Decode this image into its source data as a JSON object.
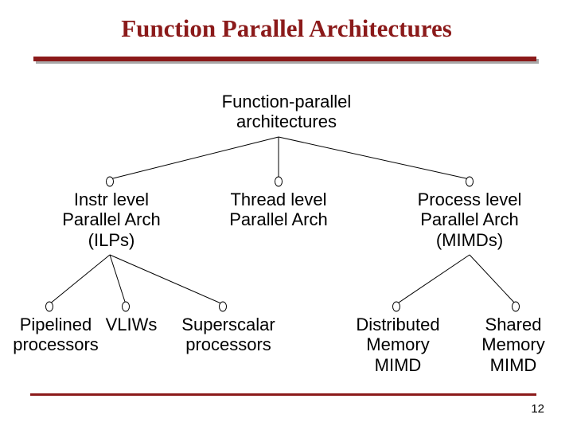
{
  "title": "Function Parallel Architectures",
  "root": {
    "line1": "Function-parallel",
    "line2": "architectures"
  },
  "level2": {
    "instr": {
      "line1": "Instr level",
      "line2": "Parallel Arch",
      "line3": "(ILPs)"
    },
    "thread": {
      "line1": "Thread level",
      "line2": "Parallel Arch"
    },
    "process": {
      "line1": "Process level",
      "line2": "Parallel Arch",
      "line3": "(MIMDs)"
    }
  },
  "leaves": {
    "pipelined": {
      "line1": "Pipelined",
      "line2": "processors"
    },
    "vliws": {
      "line1": "VLIWs"
    },
    "superscalar": {
      "line1": "Superscalar",
      "line2": "processors"
    },
    "distributed": {
      "line1": "Distributed",
      "line2": "Memory",
      "line3": "MIMD"
    },
    "shared": {
      "line1": "Shared",
      "line2": "Memory",
      "line3": "MIMD"
    }
  },
  "pagenum": "12"
}
